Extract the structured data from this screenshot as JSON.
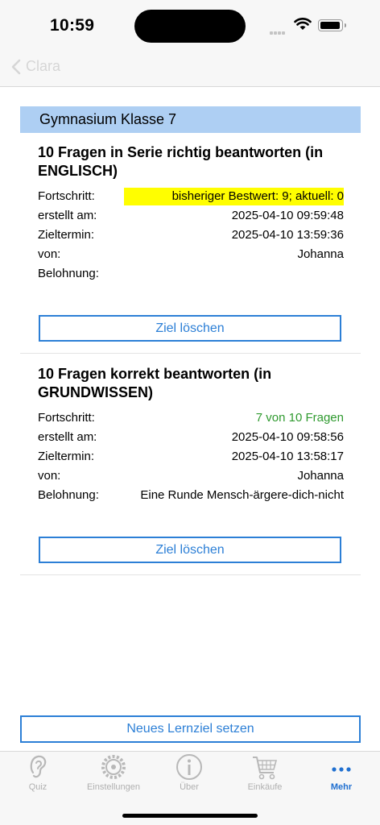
{
  "status": {
    "time": "10:59"
  },
  "nav": {
    "back_label": "Clara"
  },
  "section": {
    "title": "Gymnasium Klasse 7"
  },
  "goals": [
    {
      "title": "10 Fragen in Serie richtig beantworten (in ENGLISCH)",
      "progress_label": "Fortschritt:",
      "progress_value": "bisheriger Bestwert: 9; aktuell: 0",
      "created_label": "erstellt am:",
      "created_value": "2025-04-10 09:59:48",
      "due_label": "Zieltermin:",
      "due_value": "2025-04-10 13:59:36",
      "from_label": "von:",
      "from_value": "Johanna",
      "reward_label": "Belohnung:",
      "reward_value": "",
      "delete_label": "Ziel löschen"
    },
    {
      "title": "10 Fragen korrekt beantworten (in GRUNDWISSEN)",
      "progress_label": "Fortschritt:",
      "progress_value": "7 von 10 Fragen",
      "created_label": "erstellt am:",
      "created_value": "2025-04-10 09:58:56",
      "due_label": "Zieltermin:",
      "due_value": "2025-04-10 13:58:17",
      "from_label": "von:",
      "from_value": "Johanna",
      "reward_label": "Belohnung:",
      "reward_value": "Eine Runde Mensch-ärgere-dich-nicht",
      "delete_label": "Ziel löschen"
    }
  ],
  "new_goal_label": "Neues Lernziel setzen",
  "tabs": [
    {
      "label": "Quiz",
      "icon": "ear-icon"
    },
    {
      "label": "Einstellungen",
      "icon": "gear-icon"
    },
    {
      "label": "Über",
      "icon": "info-icon"
    },
    {
      "label": "Einkäufe",
      "icon": "cart-icon"
    },
    {
      "label": "Mehr",
      "icon": "more-icon"
    }
  ],
  "colors": {
    "accent": "#2c7fd6",
    "section_bg": "#aecff3",
    "highlight": "#fffe00",
    "progress_green": "#2f9a2f",
    "tab_active": "#1f6fd0"
  }
}
